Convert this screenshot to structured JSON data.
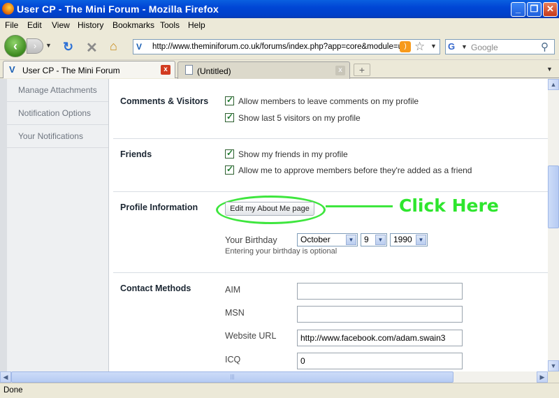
{
  "window": {
    "title": "User CP - The Mini Forum - Mozilla Firefox",
    "minimize": "_",
    "maximize": "❐",
    "close": "✕"
  },
  "menu": {
    "items": [
      {
        "label": "File"
      },
      {
        "label": "Edit"
      },
      {
        "label": "View"
      },
      {
        "label": "History"
      },
      {
        "label": "Bookmarks"
      },
      {
        "label": "Tools"
      },
      {
        "label": "Help"
      }
    ]
  },
  "nav": {
    "back_icon": "back-arrow-icon",
    "forward_icon": "forward-arrow-icon",
    "url": "http://www.theminiforum.co.uk/forums/index.php?app=core&module=u",
    "search_placeholder": "Google"
  },
  "tabs": [
    {
      "label": "User CP - The Mini Forum",
      "active": true
    },
    {
      "label": "(Untitled)",
      "active": false
    }
  ],
  "sidebar": {
    "items": [
      {
        "label": "Manage Attachments"
      },
      {
        "label": "Notification Options"
      },
      {
        "label": "Your Notifications"
      }
    ]
  },
  "sections": {
    "comments": {
      "title": "Comments & Visitors",
      "options": [
        {
          "label": "Allow members to leave comments on my profile",
          "checked": true
        },
        {
          "label": "Show last 5 visitors on my profile",
          "checked": true
        }
      ]
    },
    "friends": {
      "title": "Friends",
      "options": [
        {
          "label": "Show my friends in my profile",
          "checked": true
        },
        {
          "label": "Allow me to approve members before they're added as a friend",
          "checked": true
        }
      ]
    },
    "profile": {
      "title": "Profile Information",
      "edit_button": "Edit my About Me page",
      "annotation": "Click Here",
      "birthday_label": "Your Birthday",
      "birthday_month": "October",
      "birthday_day": "9",
      "birthday_year": "1990",
      "birthday_hint": "Entering your birthday is optional"
    },
    "contact": {
      "title": "Contact Methods",
      "fields": [
        {
          "label": "AIM",
          "value": ""
        },
        {
          "label": "MSN",
          "value": ""
        },
        {
          "label": "Website URL",
          "value": "http://www.facebook.com/adam.swain3"
        },
        {
          "label": "ICQ",
          "value": "0"
        }
      ]
    }
  },
  "status": {
    "text": "Done"
  },
  "colors": {
    "annotation_green": "#3ee63e",
    "titlebar_blue": "#0046d5"
  }
}
